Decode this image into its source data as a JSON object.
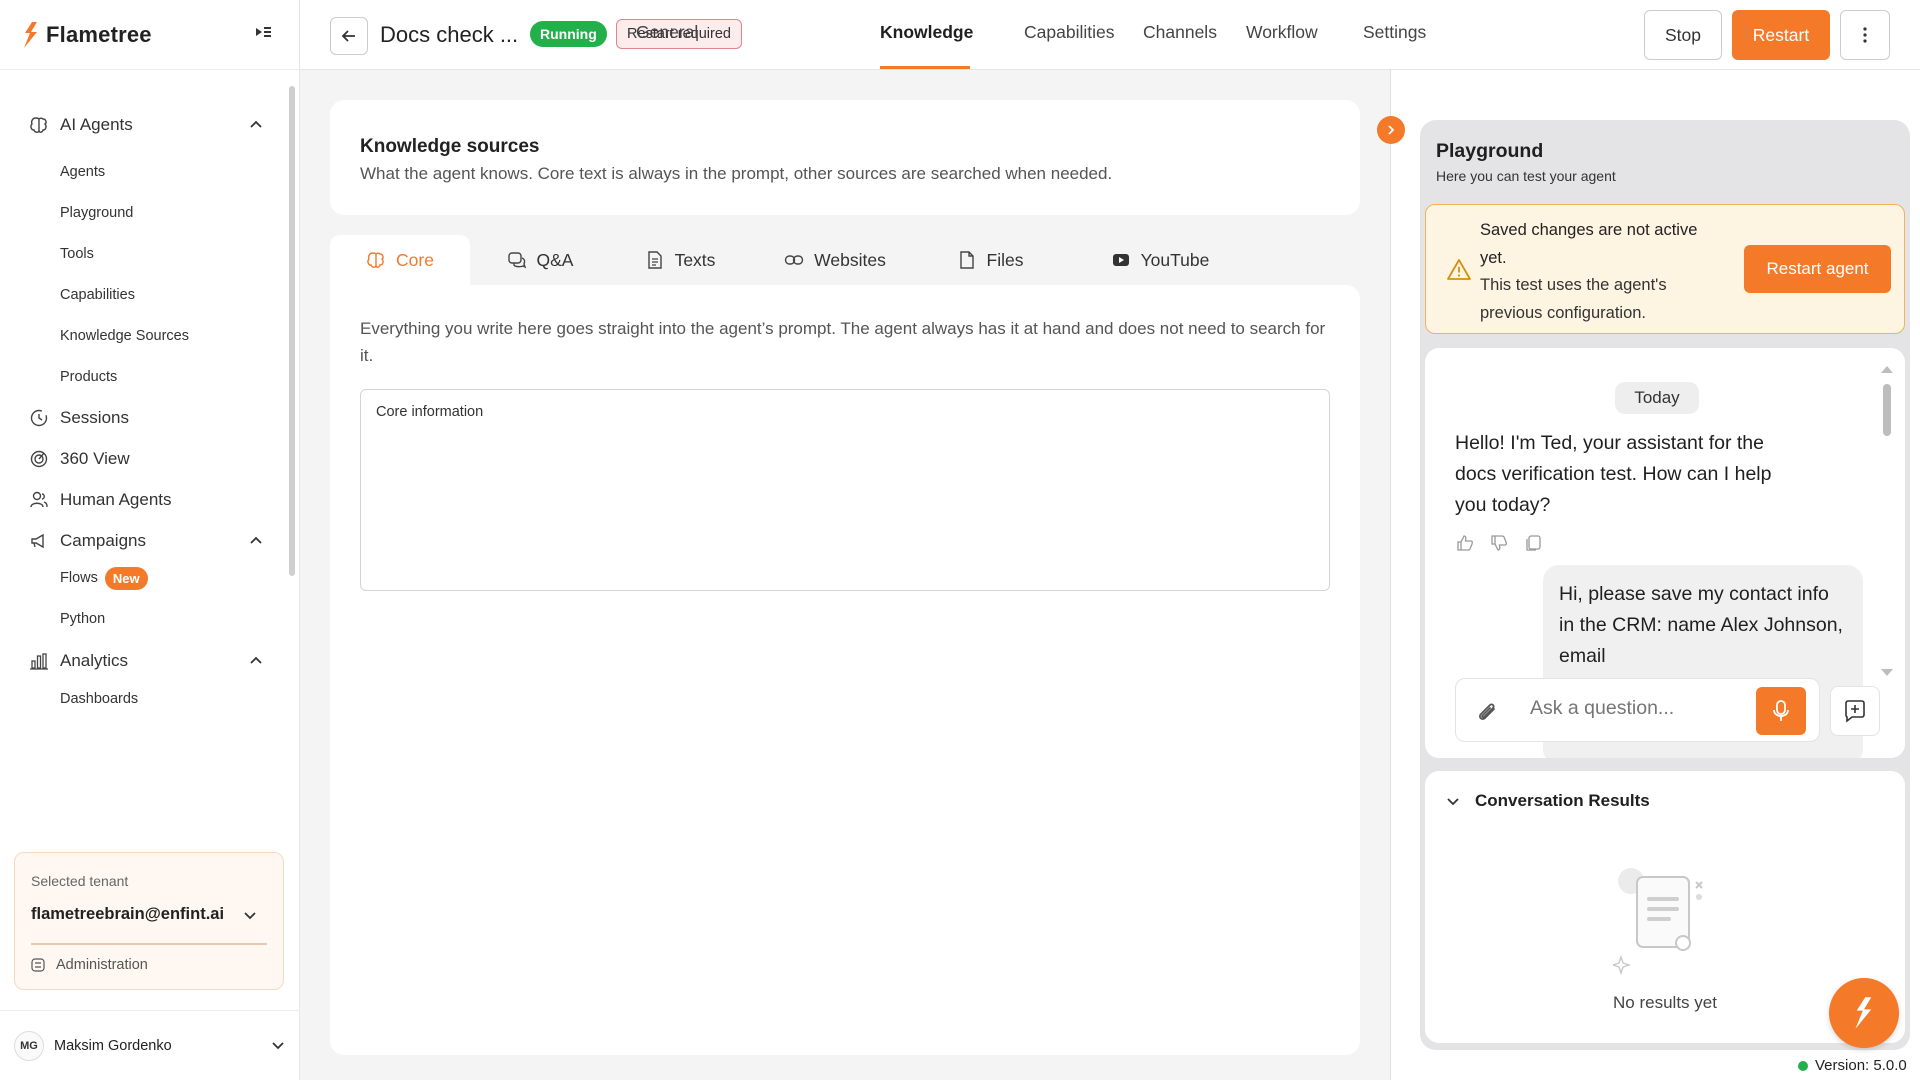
{
  "brand": {
    "name": "Flametree"
  },
  "sidebar": {
    "sections": [
      {
        "label": "AI Agents",
        "icon": "brain-icon",
        "expanded": true
      },
      {
        "label": "Sessions",
        "icon": "history-icon"
      },
      {
        "label": "360 View",
        "icon": "radar-icon"
      },
      {
        "label": "Human Agents",
        "icon": "users-icon"
      },
      {
        "label": "Campaigns",
        "icon": "megaphone-icon",
        "expanded": true
      },
      {
        "label": "Analytics",
        "icon": "bar-chart-icon",
        "expanded": true
      }
    ],
    "ai_agents_items": [
      "Agents",
      "Playground",
      "Tools",
      "Capabilities",
      "Knowledge Sources",
      "Products"
    ],
    "campaigns_items": [
      "Flows",
      "Python"
    ],
    "flows_badge": "New",
    "analytics_items": [
      "Dashboards"
    ]
  },
  "tenant": {
    "label": "Selected tenant",
    "email": "flametreebrain@enfint.ai",
    "admin_label": "Administration"
  },
  "user": {
    "initials": "MG",
    "name": "Maksim Gordenko"
  },
  "topbar": {
    "agent_title": "Docs check ...",
    "status_running": "Running",
    "status_restart_required": "Restart required",
    "tabs": [
      "General",
      "Knowledge",
      "Capabilities",
      "Channels",
      "Workflow",
      "Settings"
    ],
    "active_tab": "Knowledge",
    "stop_label": "Stop",
    "restart_label": "Restart"
  },
  "knowledge": {
    "title": "Knowledge sources",
    "description": "What the agent knows. Core text is always in the prompt, other sources are searched when needed.",
    "tabs": [
      {
        "label": "Core",
        "icon": "brain-icon"
      },
      {
        "label": "Q&A",
        "icon": "chat-bubbles-icon"
      },
      {
        "label": "Texts",
        "icon": "document-icon"
      },
      {
        "label": "Websites",
        "icon": "link-icon"
      },
      {
        "label": "Files",
        "icon": "file-icon"
      },
      {
        "label": "YouTube",
        "icon": "youtube-icon"
      }
    ],
    "active_tab": "Core",
    "core_description": "Everything you write here goes straight into the agent’s prompt. The agent always has it at hand and does not need to search for it.",
    "core_field_label": "Core information",
    "core_field_value": ""
  },
  "playground": {
    "title": "Playground",
    "subtitle": "Here you can test your agent",
    "warning_title": "Saved changes are not active yet.",
    "warning_body": "This test uses the agent's previous configuration.",
    "restart_agent_label": "Restart agent",
    "day_label": "Today",
    "bot_message": "Hello! I'm Ted, your assistant for the docs verification test. How can I help you today?",
    "user_message": "Hi, please save my contact info in the CRM: name Alex Johnson, email",
    "input_placeholder": "Ask a question..."
  },
  "results": {
    "title": "Conversation Results",
    "empty_text": "No results yet"
  },
  "version": "Version: 5.0.0",
  "colors": {
    "accent": "#f47a2a",
    "success": "#22b04a",
    "warning_bg": "#fef4e2",
    "warning_border": "#f1b25d"
  }
}
